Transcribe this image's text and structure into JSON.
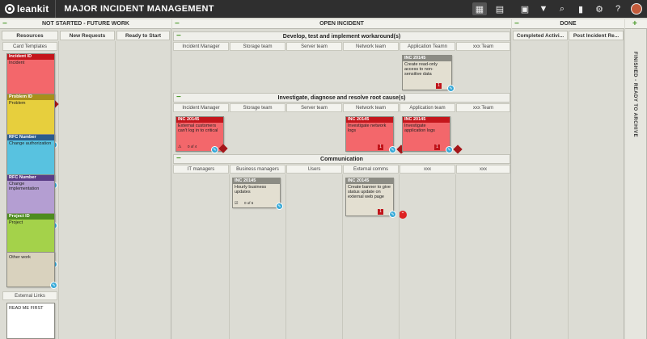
{
  "app": {
    "logo_text": "leankit",
    "board_title": "MAJOR INCIDENT MANAGEMENT"
  },
  "toolbar": {
    "icons": [
      "board-view-icon",
      "calendar-icon",
      "report-icon",
      "filter-icon",
      "search-icon",
      "analytics-icon",
      "settings-icon",
      "help-icon",
      "user-avatar"
    ]
  },
  "lanes": {
    "not_started": {
      "title": "NOT STARTED - FUTURE WORK",
      "cols": [
        "Resources",
        "New Requests",
        "Ready to Start"
      ],
      "card_templates": "Card Templates",
      "external_links": "External Links"
    },
    "open": {
      "title": "OPEN INCIDENT",
      "groups": [
        {
          "title": "Develop, test and implement workaround(s)",
          "cols": [
            "Incident Manager",
            "Storage team",
            "Server team",
            "Network team",
            "Application Teamn",
            "xxx Team"
          ]
        },
        {
          "title": "Investigate, diagnose and resolve root cause(s)",
          "cols": [
            "Incident Manager",
            "Storage team",
            "Server team",
            "Network team",
            "Application team",
            "xxx Team"
          ]
        },
        {
          "title": "Communication",
          "cols": [
            "IT managers",
            "Business managers",
            "Users",
            "External comms",
            "xxx",
            "xxx"
          ]
        }
      ]
    },
    "done": {
      "title": "DONE",
      "cols": [
        "Completed Activi...",
        "Post Incident Re..."
      ]
    },
    "archive": {
      "title": "FINISHED - READY TO ARCHIVE"
    }
  },
  "templates": [
    {
      "id": "Incident ID",
      "text": "Incident",
      "color": "#f3676b"
    },
    {
      "id": "Problem ID",
      "text": "Problem",
      "color": "#e7cf3d"
    },
    {
      "id": "RFC Number",
      "text": "Change authorization",
      "color": "#58c2e0"
    },
    {
      "id": "RFC Number",
      "text": "Change implementation",
      "color": "#b49ed2"
    },
    {
      "id": "Project ID",
      "text": "Project",
      "color": "#a4d24a"
    },
    {
      "id": "",
      "text": "Other work",
      "color": "#d9d2be"
    }
  ],
  "readme": "READ ME FIRST",
  "cards": {
    "workaround_app": {
      "id": "INC 20145",
      "text": "Create read-only access to non-sensitive data",
      "badge": "1"
    },
    "root_im": {
      "id": "INC 20145",
      "text": "External customers can't log in to critical",
      "progress": "0 of 4"
    },
    "root_net": {
      "id": "INC 20145",
      "text": "Investigate network logs",
      "badge": "1"
    },
    "root_app": {
      "id": "INC 20145",
      "text": "Investigate application logs",
      "badge": "1"
    },
    "comm_biz": {
      "id": "INC 20145",
      "text": "Hourly business updates",
      "progress": "0 of 6"
    },
    "comm_ext": {
      "id": "INC 20145",
      "text": "Create banner to give status update on external web page",
      "badge": "1"
    }
  }
}
